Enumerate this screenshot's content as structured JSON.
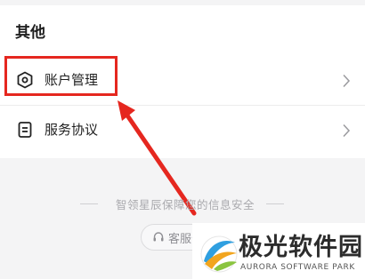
{
  "section": {
    "title": "其他"
  },
  "rows": [
    {
      "label": "账户管理",
      "icon": "hexagon-settings-icon"
    },
    {
      "label": "服务协议",
      "icon": "document-icon"
    }
  ],
  "footer": {
    "security_text": "智领星辰保障您的信息安全",
    "service_button": "客服咨询"
  },
  "watermark": {
    "title": "极光软件园",
    "subtitle": "AURORA SOFTWARE PARK"
  },
  "colors": {
    "highlight": "#e5271f",
    "background": "#f4f4f5"
  }
}
